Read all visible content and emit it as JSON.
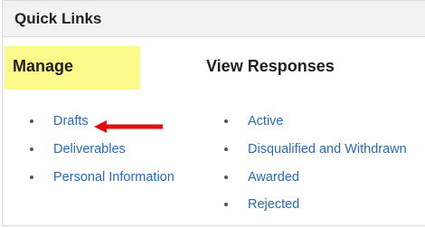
{
  "panel": {
    "title": "Quick Links"
  },
  "columns": {
    "manage": {
      "heading": "Manage",
      "links": [
        "Drafts",
        "Deliverables",
        "Personal Information"
      ]
    },
    "view_responses": {
      "heading": "View Responses",
      "links": [
        "Active",
        "Disqualified and Withdrawn",
        "Awarded",
        "Rejected"
      ]
    }
  },
  "colors": {
    "highlight": "#fbf98a",
    "link": "#2a6bb3",
    "arrow": "#e01010"
  },
  "annotations": {
    "arrow_icon": "red-left-arrow-icon"
  }
}
